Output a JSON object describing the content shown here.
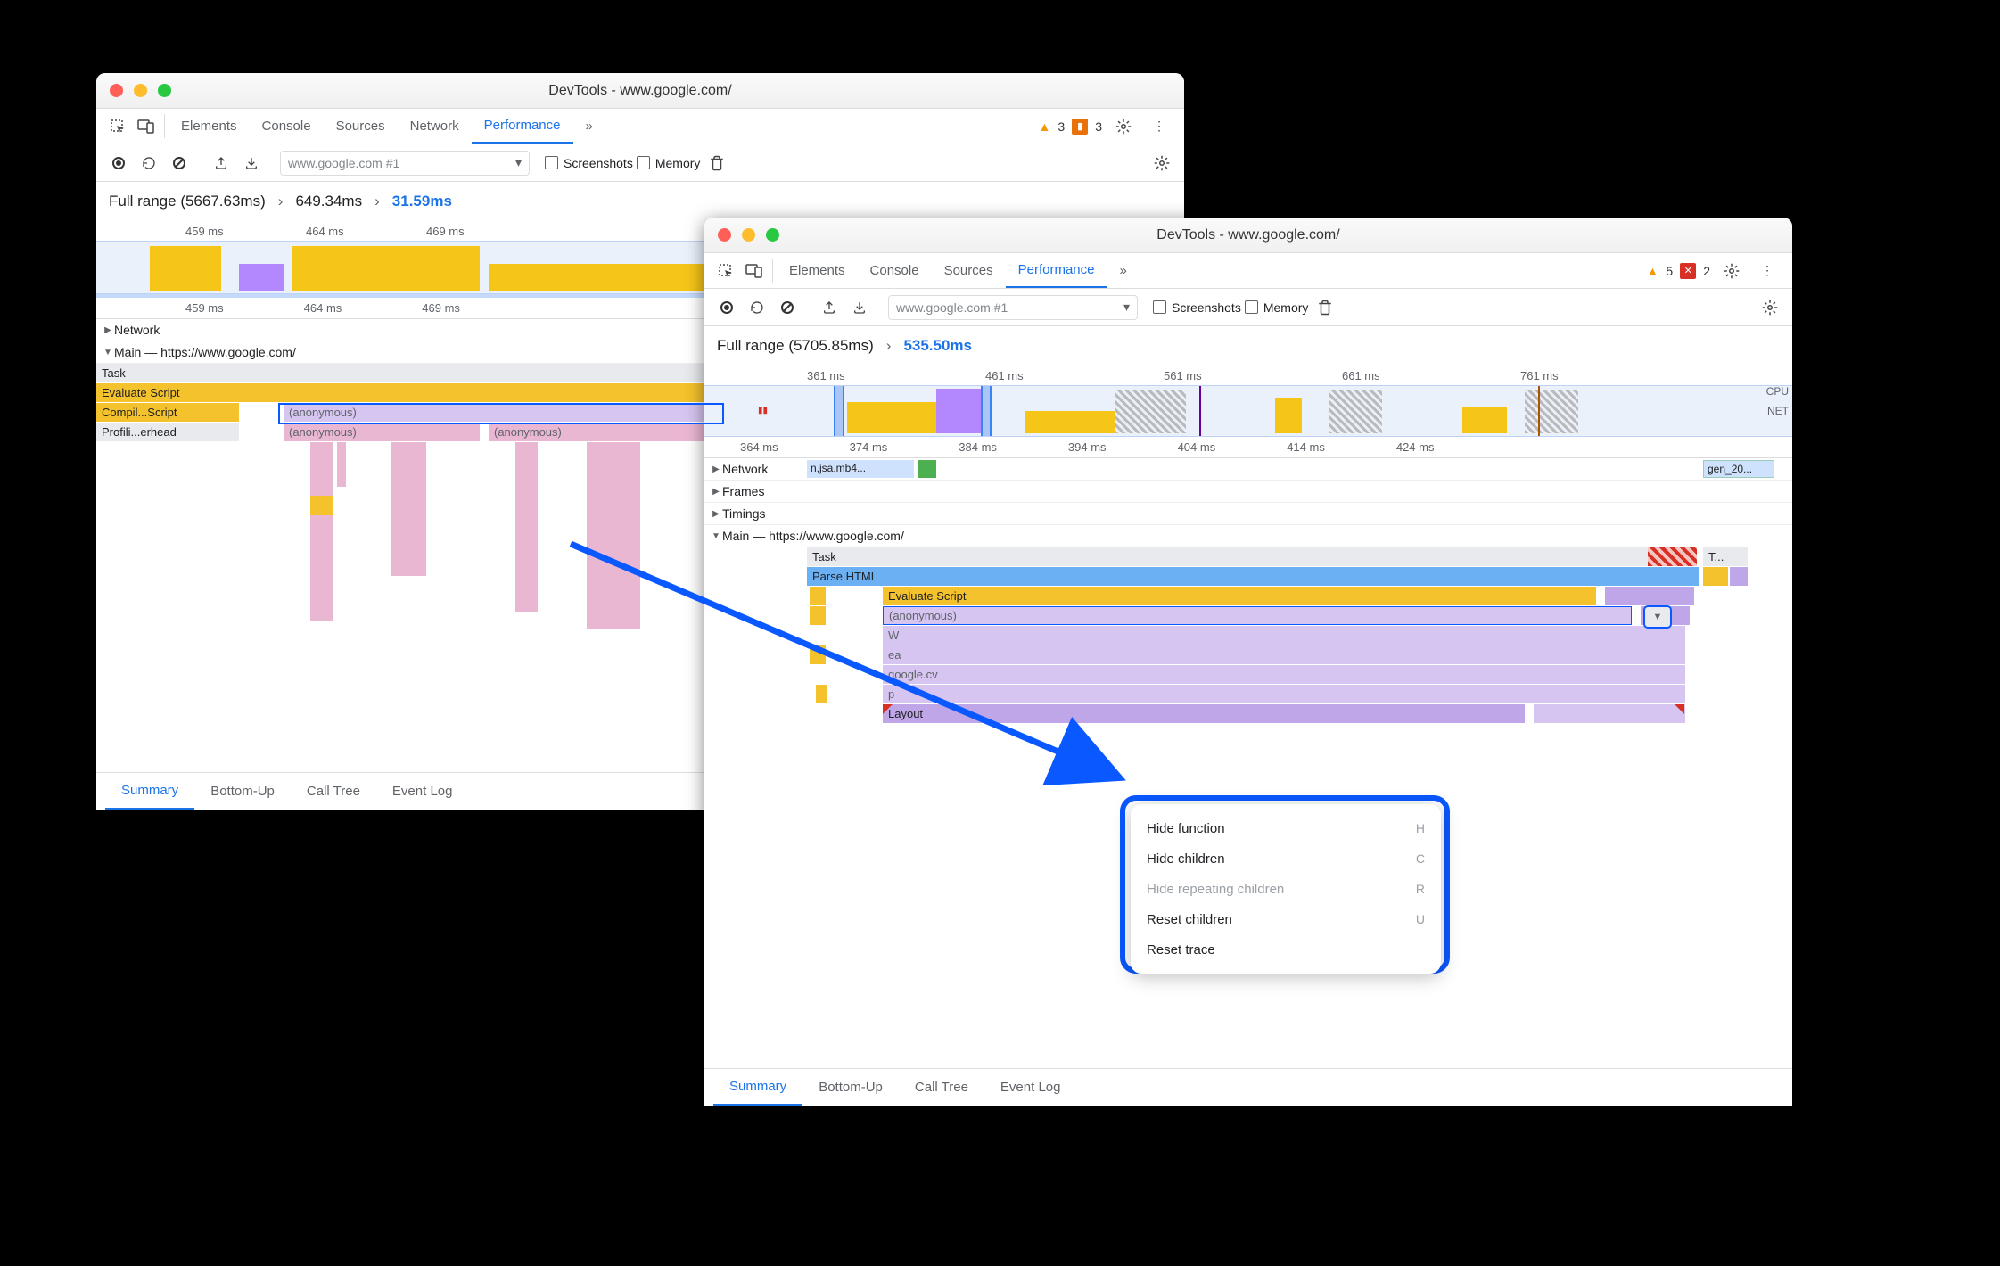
{
  "windowA": {
    "title": "DevTools - www.google.com/",
    "tabs": {
      "elements": "Elements",
      "console": "Console",
      "sources": "Sources",
      "network": "Network",
      "performance": "Performance",
      "more": "»"
    },
    "warnings": "3",
    "issues": "3",
    "toolbar": {
      "dropdown": "www.google.com #1",
      "screenshots": "Screenshots",
      "memory": "Memory"
    },
    "crumbs": {
      "full": "Full range (5667.63ms)",
      "mid": "649.34ms",
      "last": "31.59ms"
    },
    "ruler": [
      "459 ms",
      "464 ms",
      "469 ms"
    ],
    "ruler2": [
      "459 ms",
      "464 ms",
      "469 ms"
    ],
    "sections": {
      "network": "Network",
      "main": "Main — https://www.google.com/"
    },
    "flame": {
      "task": "Task",
      "evalScript": "Evaluate Script",
      "compile": "Compil...Script",
      "anon1": "(anonymous)",
      "profiler": "Profili...erhead",
      "anon2": "(anonymous)",
      "anon3": "(anonymous)"
    },
    "bottomTabs": {
      "summary": "Summary",
      "bottomUp": "Bottom-Up",
      "callTree": "Call Tree",
      "eventLog": "Event Log"
    }
  },
  "windowB": {
    "title": "DevTools - www.google.com/",
    "tabs": {
      "elements": "Elements",
      "console": "Console",
      "sources": "Sources",
      "performance": "Performance",
      "more": "»"
    },
    "warnings": "5",
    "errors": "2",
    "toolbar": {
      "dropdown": "www.google.com #1",
      "screenshots": "Screenshots",
      "memory": "Memory"
    },
    "crumbs": {
      "full": "Full range (5705.85ms)",
      "last": "535.50ms"
    },
    "ruler": [
      "361 ms",
      "461 ms",
      "561 ms",
      "661 ms",
      "761 ms"
    ],
    "ruler2": [
      "364 ms",
      "374 ms",
      "384 ms",
      "394 ms",
      "404 ms",
      "414 ms",
      "424 ms"
    ],
    "trackLabels": {
      "cpu": "CPU",
      "net": "NET"
    },
    "sections": {
      "network": "Network",
      "networkItem": "n,jsa,mb4...",
      "networkItem2": "gen_20...",
      "frames": "Frames",
      "timings": "Timings",
      "main": "Main — https://www.google.com/"
    },
    "flame": {
      "task": "Task",
      "task2": "T...",
      "parseHtml": "Parse HTML",
      "evalScript": "Evaluate Script",
      "anon": "(anonymous)",
      "W": "W",
      "ea": "ea",
      "googlecv": "google.cv",
      "p": "p",
      "layout": "Layout"
    },
    "contextMenu": {
      "hideFn": "Hide function",
      "hideFnKey": "H",
      "hideCh": "Hide children",
      "hideChKey": "C",
      "hideRep": "Hide repeating children",
      "hideRepKey": "R",
      "resetCh": "Reset children",
      "resetChKey": "U",
      "resetTr": "Reset trace"
    },
    "bottomTabs": {
      "summary": "Summary",
      "bottomUp": "Bottom-Up",
      "callTree": "Call Tree",
      "eventLog": "Event Log"
    }
  }
}
